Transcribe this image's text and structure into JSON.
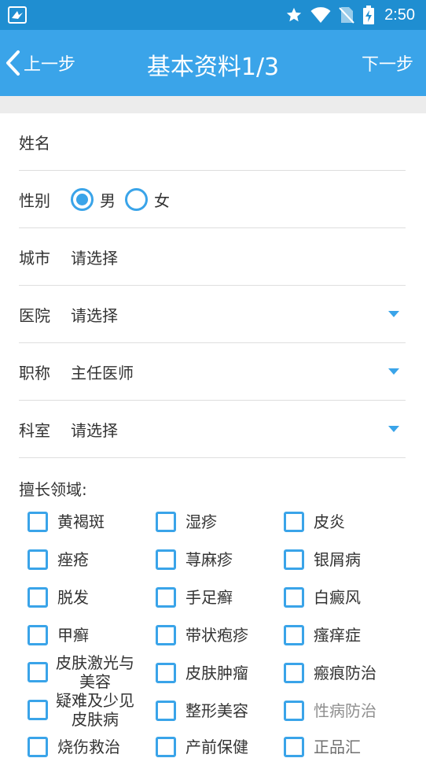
{
  "status_bar": {
    "time": "2:50",
    "icons": [
      "app-bird-icon",
      "star-icon",
      "wifi-icon",
      "no-sim-icon",
      "battery-charging-icon"
    ]
  },
  "nav": {
    "back_label": "上一步",
    "title": "基本资料1/3",
    "next_label": "下一步"
  },
  "form": {
    "name_label": "姓名",
    "gender_label": "性别",
    "gender_options": [
      "男",
      "女"
    ],
    "gender_selected": "男",
    "city_label": "城市",
    "city_value": "请选择",
    "hospital_label": "医院",
    "hospital_value": "请选择",
    "title_label": "职称",
    "title_value": "主任医师",
    "department_label": "科室",
    "department_value": "请选择"
  },
  "expertise": {
    "title": "擅长领域:",
    "items": [
      "黄褐斑",
      "湿疹",
      "皮炎",
      "痤疮",
      "荨麻疹",
      "银屑病",
      "脱发",
      "手足癣",
      "白癜风",
      "甲癣",
      "带状疱疹",
      "瘙痒症",
      "皮肤激光与美容",
      "皮肤肿瘤",
      "瘢痕防治",
      "疑难及少见皮肤病",
      "整形美容",
      "性病防治",
      "烧伤救治",
      "产前保健",
      "正品汇"
    ]
  },
  "colors": {
    "status_bar": "#1f8ed1",
    "nav_bar": "#3aa4e9",
    "accent": "#3aa4e9"
  }
}
